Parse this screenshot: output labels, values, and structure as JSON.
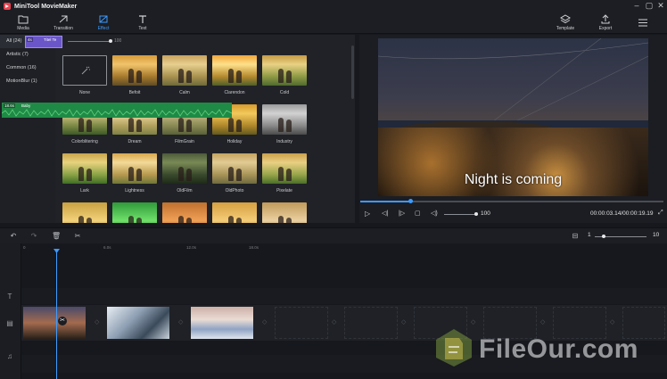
{
  "app": {
    "title": "MiniTool MovieMaker"
  },
  "toolbar": {
    "tabs": [
      {
        "label": "Media",
        "icon": "folder-icon"
      },
      {
        "label": "Transition",
        "icon": "transition-icon"
      },
      {
        "label": "Effect",
        "icon": "effect-icon",
        "active": true
      },
      {
        "label": "Text",
        "icon": "text-t-icon"
      }
    ],
    "template_label": "Template",
    "export_label": "Export"
  },
  "categories": [
    {
      "label": "All (24)",
      "active": true
    },
    {
      "label": "Artistic (7)"
    },
    {
      "label": "Common (16)"
    },
    {
      "label": "MotionBlur (1)"
    }
  ],
  "effect_panel": {
    "intensity_label": "100"
  },
  "effects": [
    {
      "name": "None",
      "style": "none"
    },
    {
      "name": "Befoit",
      "style": "linear-gradient(180deg,#d69a3a 0%,#f1c46b 30%,#a77a2d 70%,#5e4b25 100%)"
    },
    {
      "name": "Calm",
      "style": "linear-gradient(180deg,#c9a25e 0%,#e7cf8f 30%,#a99150 70%,#6d6a3a 100%)"
    },
    {
      "name": "Clarendon",
      "style": "linear-gradient(180deg,#f0a63a 0%,#ffe08a 30%,#b58a2e 70%,#4e5f2a 100%)"
    },
    {
      "name": "Cold",
      "style": "linear-gradient(180deg,#c59a44 0%,#e9d184 30%,#8f9a45 70%,#4f6a2e 100%)"
    },
    {
      "name": "Colorblitering",
      "style": "linear-gradient(180deg,#b99a50 0%,#d7c88c 30%,#7d8a45 70%,#3c5a26 100%)"
    },
    {
      "name": "Dream",
      "style": "linear-gradient(180deg,#d8b470 0%,#efdda5 30%,#b3a25e 70%,#7d7f45 100%)"
    },
    {
      "name": "FilmGrain",
      "style": "linear-gradient(180deg,#a99a62 0%,#c8bd8a 30%,#8a8a55 70%,#5a5f38 100%)"
    },
    {
      "name": "Holiday",
      "style": "linear-gradient(180deg,#d69a2a 0%,#f3c95c 30%,#b0882a 70%,#63581f 100%)"
    },
    {
      "name": "Industry",
      "style": "linear-gradient(180deg,#9a9a9a 0%,#d2d2d2 30%,#8a8a8a 70%,#4a4a4a 100%)"
    },
    {
      "name": "Lark",
      "style": "linear-gradient(180deg,#c9a44a 0%,#e8d27e 30%,#8aa346 70%,#3f6e25 100%)"
    },
    {
      "name": "Lightness",
      "style": "linear-gradient(180deg,#d8a84c 0%,#f4d998 30%,#b79a4f 70%,#6d7636 100%)"
    },
    {
      "name": "OldFilm",
      "style": "linear-gradient(180deg,#4c5a3a 0%,#7a8a55 30%,#3a4a2c 70%,#1e2a18 100%)"
    },
    {
      "name": "OldPhoto",
      "style": "linear-gradient(180deg,#c4a35f 0%,#e2cb94 30%,#a99458 70%,#6e6a3e 100%)"
    },
    {
      "name": "Pixelate",
      "style": "linear-gradient(180deg,#c9a04a 0%,#e9cf82 30%,#98a54a 70%,#4a6f28 100%)"
    },
    {
      "name": "",
      "style": "linear-gradient(180deg,#c8a040 0%,#f2d27a 60%,#9b7f2e 100%)"
    },
    {
      "name": "",
      "style": "linear-gradient(180deg,#2f9a3a 0%,#6fe06a 60%,#2c7f2e 100%)"
    },
    {
      "name": "",
      "style": "linear-gradient(180deg,#c0702e 0%,#f0a055 60%,#8a4e22 100%)"
    },
    {
      "name": "",
      "style": "linear-gradient(180deg,#d6a040 0%,#f4cc78 60%,#9c7a34 100%)"
    },
    {
      "name": "",
      "style": "linear-gradient(180deg,#c09a5a 0%,#ead0a0 60%,#8c7446 100%)"
    }
  ],
  "preview": {
    "caption": "Night is coming",
    "progress": 0.165,
    "volume": 100,
    "volume_label": "100",
    "timecode": "00:00:03.14/00:00:19.19"
  },
  "timeline": {
    "zoom_min": "1",
    "zoom_max": "10",
    "zoom_value": 0.14,
    "ruler": [
      "0",
      "6.0s",
      "12.0s",
      "18.0s"
    ],
    "text_clip": {
      "duration": "4s",
      "name": "Titel Te"
    },
    "audio_clip": {
      "duration": "18.6s",
      "name": "Baby"
    }
  },
  "watermark": {
    "text": "FileOur.com"
  }
}
